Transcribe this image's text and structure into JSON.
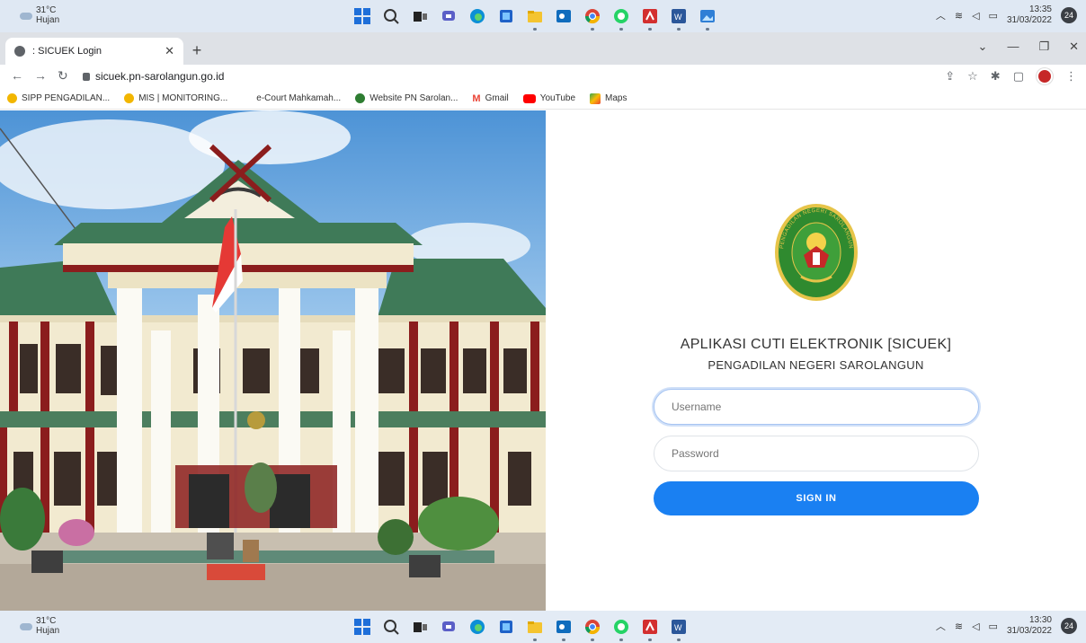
{
  "taskbar_top": {
    "weather_temp": "31°C",
    "weather_desc": "Hujan",
    "time": "13:35",
    "date": "31/03/2022",
    "notification_count": "24"
  },
  "taskbar_bottom": {
    "weather_temp": "31°C",
    "weather_desc": "Hujan",
    "time": "13:30",
    "date": "31/03/2022",
    "notification_count": "24"
  },
  "browser": {
    "tab_title": ": SICUEK Login",
    "url": "sicuek.pn-sarolangun.go.id",
    "bookmarks": [
      {
        "label": "SIPP PENGADILAN...",
        "color": "#f2b600"
      },
      {
        "label": "MIS | MONITORING...",
        "color": "#f2b600"
      },
      {
        "label": "e-Court Mahkamah...",
        "color": "#ffffff"
      },
      {
        "label": "Website PN Sarolan...",
        "color": "#2e7d32"
      },
      {
        "label": "Gmail",
        "color": "#ea4335"
      },
      {
        "label": "YouTube",
        "color": "#ff0000"
      },
      {
        "label": "Maps",
        "color": "#34a853"
      }
    ]
  },
  "login": {
    "title": "APLIKASI CUTI ELEKTRONIK [SICUEK]",
    "subtitle": "PENGADILAN NEGERI SAROLANGUN",
    "username_placeholder": "Username",
    "password_placeholder": "Password",
    "signin_label": "SIGN IN",
    "seal_text": "PENGADILAN NEGERI SAROLANGUN"
  },
  "colors": {
    "primary_button": "#1a80f2",
    "seal_green": "#2f8a2f"
  }
}
